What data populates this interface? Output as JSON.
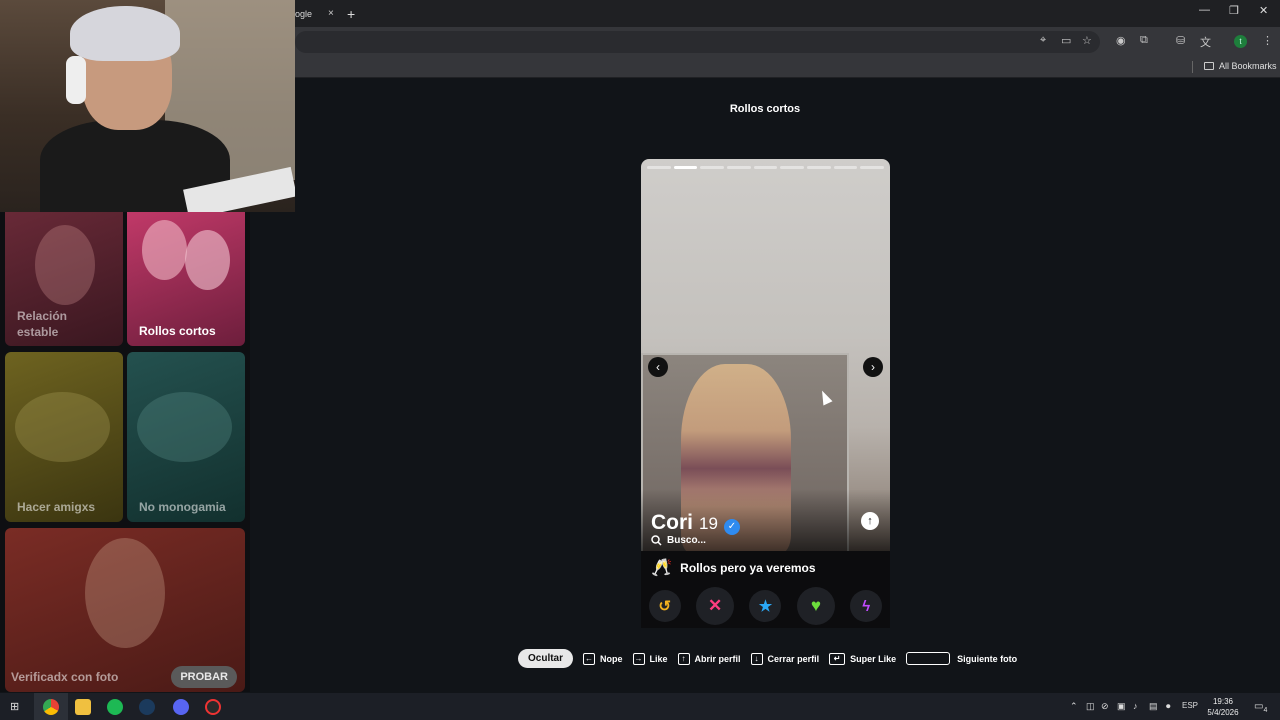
{
  "browser": {
    "tab_title": "ogle",
    "tab_close": "×",
    "new_tab": "+",
    "window_controls": [
      "—",
      "❐",
      "✕"
    ],
    "bookmarks_all": "All Bookmarks",
    "toolbar_icons": [
      "location-icon",
      "cast-icon",
      "star-icon",
      "extension-icon",
      "puzzle-icon",
      "profile-sync-icon",
      "translate-icon",
      "profile-avatar",
      "menu-icon"
    ],
    "profile_letter": "t"
  },
  "page": {
    "title": "Rollos cortos"
  },
  "sidebar": {
    "tiles": [
      {
        "label_line1": "Relación",
        "label_line2": "estable"
      },
      {
        "label": "Rollos cortos"
      },
      {
        "label": "Hacer amigxs"
      },
      {
        "label": "No monogamia"
      },
      {
        "label": "Verificadx con foto",
        "button": "PROBAR"
      }
    ]
  },
  "card": {
    "photo_count": 9,
    "active_photo": 2,
    "name": "Cori",
    "age": "19",
    "verified_icon": "✓",
    "busco_label": "Busco...",
    "looking_for_emoji": "🥂",
    "looking_for": "Rollos pero ya veremos",
    "prev_icon": "‹",
    "next_icon": "›",
    "info_icon": "↑"
  },
  "actions": {
    "undo": "↺",
    "nope": "✕",
    "superlike": "★",
    "like": "♥",
    "boost": "ϟ"
  },
  "legend": {
    "hide": "Ocultar",
    "nope": "Nope",
    "like": "Like",
    "open_profile": "Abrir perfil",
    "close_profile": "Cerrar perfil",
    "super_like": "Super Like",
    "next_photo": "Siguiente foto",
    "key_left": "←",
    "key_right": "→",
    "key_up": "↑",
    "key_down": "↓",
    "key_enter": "↵"
  },
  "taskbar": {
    "lang": "ESP",
    "time": "19:36",
    "date": "5/4/2026",
    "notifications": "4"
  },
  "colors": {
    "bg": "#111418",
    "verified": "#2f8bf0",
    "nope": "#ff3d80",
    "like": "#6cde3c",
    "superlike": "#2aa7f5",
    "boost": "#c14bff",
    "undo": "#f2b01e"
  }
}
